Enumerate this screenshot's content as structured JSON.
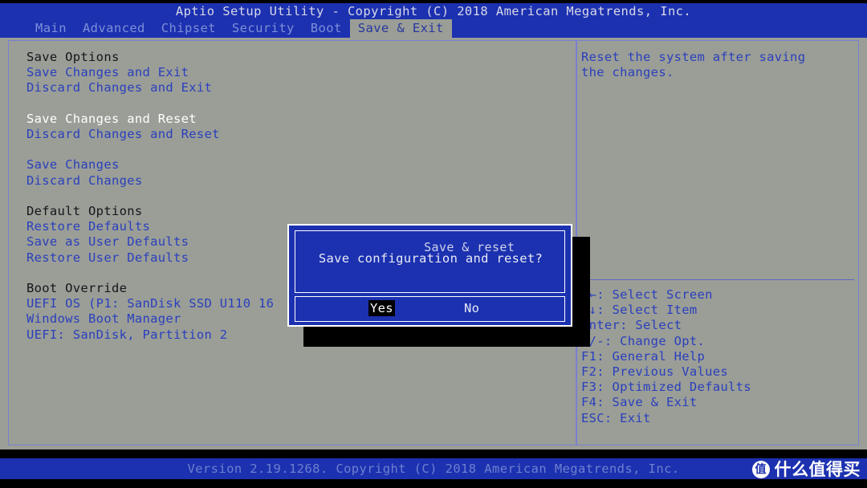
{
  "title": "Aptio Setup Utility - Copyright (C) 2018 American Megatrends, Inc.",
  "tabs": [
    {
      "label": "Main",
      "active": false
    },
    {
      "label": "Advanced",
      "active": false
    },
    {
      "label": "Chipset",
      "active": false
    },
    {
      "label": "Security",
      "active": false
    },
    {
      "label": "Boot",
      "active": false
    },
    {
      "label": "Save & Exit",
      "active": true
    }
  ],
  "menu": [
    {
      "label": "Save Options",
      "style": "header"
    },
    {
      "label": "Save Changes and Exit",
      "style": "item"
    },
    {
      "label": "Discard Changes and Exit",
      "style": "item"
    },
    {
      "label": "",
      "style": "gap"
    },
    {
      "label": "Save Changes and Reset",
      "style": "selected"
    },
    {
      "label": "Discard Changes and Reset",
      "style": "item"
    },
    {
      "label": "",
      "style": "gap"
    },
    {
      "label": "Save Changes",
      "style": "item"
    },
    {
      "label": "Discard Changes",
      "style": "item"
    },
    {
      "label": "",
      "style": "gap"
    },
    {
      "label": "Default Options",
      "style": "header"
    },
    {
      "label": "Restore Defaults",
      "style": "item"
    },
    {
      "label": "Save as User Defaults",
      "style": "item"
    },
    {
      "label": "Restore User Defaults",
      "style": "item"
    },
    {
      "label": "",
      "style": "gap"
    },
    {
      "label": "Boot Override",
      "style": "header"
    },
    {
      "label": "UEFI OS (P1: SanDisk SSD U110 16",
      "style": "item"
    },
    {
      "label": "Windows Boot Manager",
      "style": "item"
    },
    {
      "label": "UEFI: SanDisk, Partition 2",
      "style": "item"
    }
  ],
  "help": {
    "description": [
      "Reset the system after saving",
      "the changes."
    ],
    "keys": [
      "→←: Select Screen",
      "↑↓: Select Item",
      "Enter: Select",
      "+/-: Change Opt.",
      "F1: General Help",
      "F2: Previous Values",
      "F3: Optimized Defaults",
      "F4: Save & Exit",
      "ESC: Exit"
    ]
  },
  "dialog": {
    "title": "Save & reset",
    "message": "Save configuration and reset?",
    "yes_label": "Yes",
    "no_label": "No",
    "selected": "Yes"
  },
  "footer": {
    "version_text": "Version 2.19.1268. Copyright (C) 2018 American Megatrends, Inc."
  },
  "watermark": {
    "logo_char": "值",
    "text": "什么值得买"
  },
  "colors": {
    "bios_blue": "#1c31b0",
    "panel_gray": "#9a9e96",
    "menu_blue": "#2b3fbe",
    "selected_white": "#ffffff",
    "border_violet": "#7b7fd2"
  }
}
